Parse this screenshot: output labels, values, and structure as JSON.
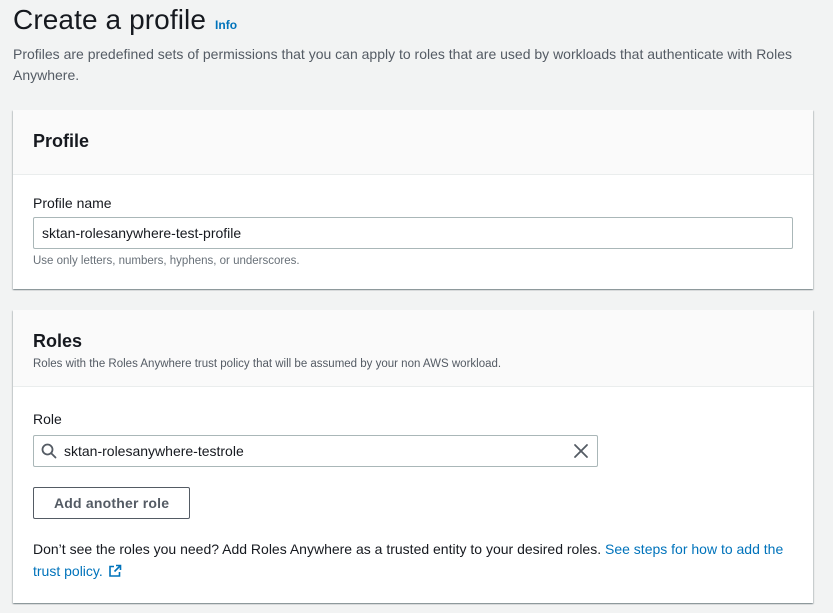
{
  "header": {
    "title": "Create a profile",
    "info_label": "Info",
    "description": "Profiles are predefined sets of permissions that you can apply to roles that are used by workloads that authenticate with Roles Anywhere."
  },
  "profile_panel": {
    "title": "Profile",
    "profile_name_label": "Profile name",
    "profile_name_value": "sktan-rolesanywhere-test-profile",
    "profile_name_hint": "Use only letters, numbers, hyphens, or underscores."
  },
  "roles_panel": {
    "title": "Roles",
    "description": "Roles with the Roles Anywhere trust policy that will be assumed by your non AWS workload.",
    "role_label": "Role",
    "role_value": "sktan-rolesanywhere-testrole",
    "add_role_button": "Add another role",
    "help_text": "Don’t see the roles you need? Add Roles Anywhere as a trusted entity to your desired roles. ",
    "help_link": "See steps for how to add the trust policy."
  },
  "icons": {
    "search": "search-icon",
    "clear": "close-icon",
    "external": "external-link-icon"
  },
  "colors": {
    "link": "#0073bb",
    "background": "#f2f3f3",
    "panel_header": "#fafafa"
  }
}
